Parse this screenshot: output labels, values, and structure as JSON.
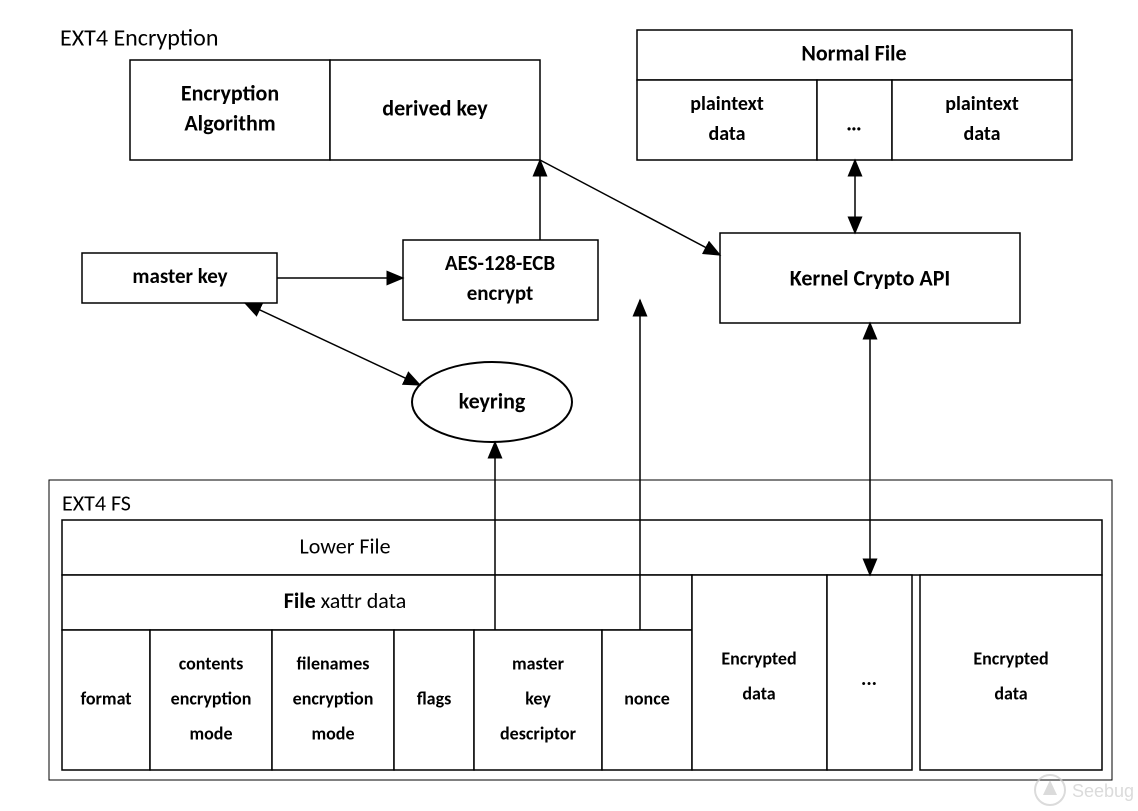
{
  "title": "EXT4 Encryption",
  "ext4fs_label": "EXT4 FS",
  "encryption_algorithm": "Encryption Algorithm",
  "derived_key": "derived key",
  "normal_file": "Normal File",
  "plaintext_data": "plaintext data",
  "ellipsis": "…",
  "ellipsis3": "...",
  "master_key": "master key",
  "aes_ecb": "AES-128-ECB encrypt",
  "kernel_crypto_api": "Kernel Crypto API",
  "keyring": "keyring",
  "lower_file": "Lower File",
  "file_xattr_bold": "File",
  "file_xattr_rest": " xattr data",
  "format": "format",
  "contents_mode": "contents encryption mode",
  "filenames_mode": "filenames encryption mode",
  "flags": "flags",
  "master_key_descriptor": "master key descriptor",
  "nonce": "nonce",
  "encrypted_data": "Encrypted data",
  "watermark": "Seebug"
}
